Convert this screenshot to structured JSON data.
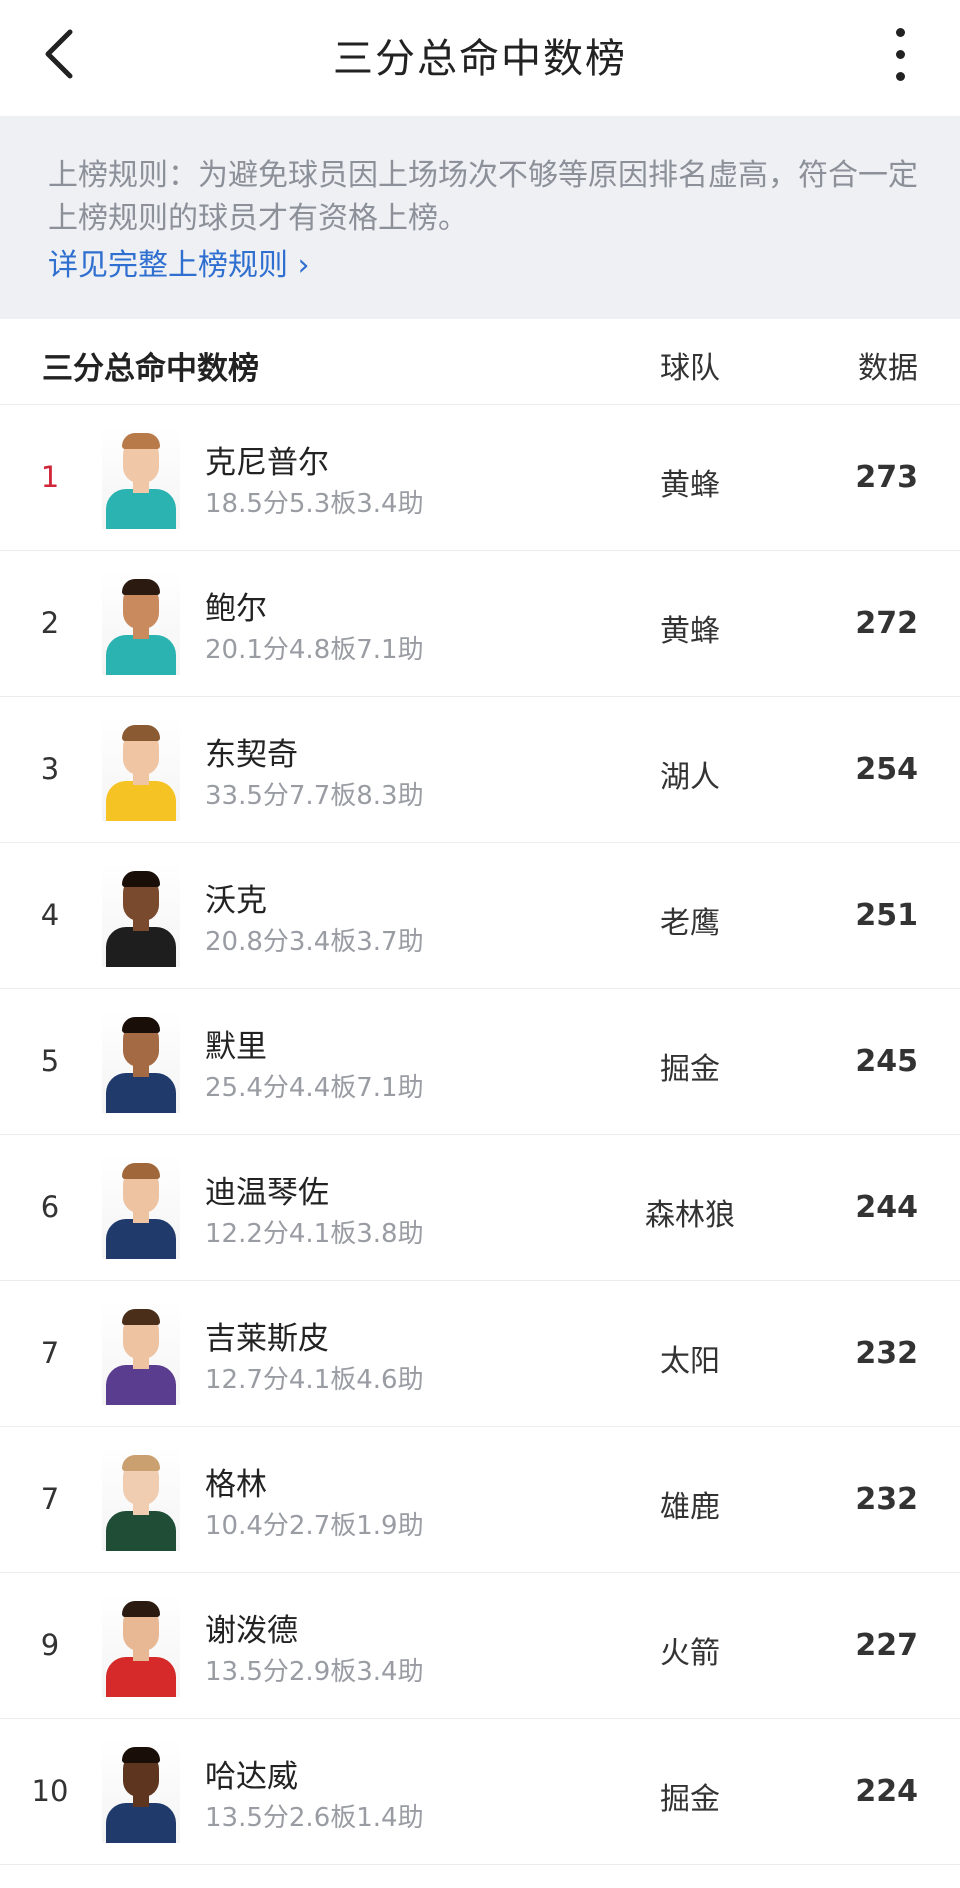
{
  "header": {
    "title": "三分总命中数榜"
  },
  "rules": {
    "text": "上榜规则：为避免球员因上场场次不够等原因排名虚高，符合一定上榜规则的球员才有资格上榜。",
    "link_label": "详见完整上榜规则 ›"
  },
  "table": {
    "title": "三分总命中数榜",
    "team_col": "球队",
    "data_col": "数据",
    "rows": [
      {
        "rank": "1",
        "name": "克尼普尔",
        "stats": "18.5分5.3板3.4助",
        "team": "黄蜂",
        "value": "273",
        "jersey": "#2bb3b1",
        "skin": "#f0c8a8",
        "hair": "#b97a4a"
      },
      {
        "rank": "2",
        "name": "鲍尔",
        "stats": "20.1分4.8板7.1助",
        "team": "黄蜂",
        "value": "272",
        "jersey": "#2bb3b1",
        "skin": "#c98a5e",
        "hair": "#2a1a10"
      },
      {
        "rank": "3",
        "name": "东契奇",
        "stats": "33.5分7.7板8.3助",
        "team": "湖人",
        "value": "254",
        "jersey": "#f5c324",
        "skin": "#efc5a4",
        "hair": "#8a5a32"
      },
      {
        "rank": "4",
        "name": "沃克",
        "stats": "20.8分3.4板3.7助",
        "team": "老鹰",
        "value": "251",
        "jersey": "#1e1e1e",
        "skin": "#7a4a2e",
        "hair": "#1a0f08"
      },
      {
        "rank": "5",
        "name": "默里",
        "stats": "25.4分4.4板7.1助",
        "team": "掘金",
        "value": "245",
        "jersey": "#1f3a6b",
        "skin": "#a46a44",
        "hair": "#1a0f08"
      },
      {
        "rank": "6",
        "name": "迪温琴佐",
        "stats": "12.2分4.1板3.8助",
        "team": "森林狼",
        "value": "244",
        "jersey": "#1f3a6b",
        "skin": "#eec3a2",
        "hair": "#a0683a"
      },
      {
        "rank": "7",
        "name": "吉莱斯皮",
        "stats": "12.7分4.1板4.6助",
        "team": "太阳",
        "value": "232",
        "jersey": "#5b3d8f",
        "skin": "#eec3a2",
        "hair": "#4a2e1a"
      },
      {
        "rank": "7",
        "name": "格林",
        "stats": "10.4分2.7板1.9助",
        "team": "雄鹿",
        "value": "232",
        "jersey": "#1f4d36",
        "skin": "#f0cdb0",
        "hair": "#caa070"
      },
      {
        "rank": "9",
        "name": "谢泼德",
        "stats": "13.5分2.9板3.4助",
        "team": "火箭",
        "value": "227",
        "jersey": "#d62a2a",
        "skin": "#e8b894",
        "hair": "#2a1a10"
      },
      {
        "rank": "10",
        "name": "哈达威",
        "stats": "13.5分2.6板1.4助",
        "team": "掘金",
        "value": "224",
        "jersey": "#1f3a6b",
        "skin": "#5e3620",
        "hair": "#1a0f08"
      }
    ]
  },
  "colors": {
    "accent_rank": "#d0263a",
    "link": "#2f6fd0",
    "rules_bg": "#eef0f4"
  }
}
